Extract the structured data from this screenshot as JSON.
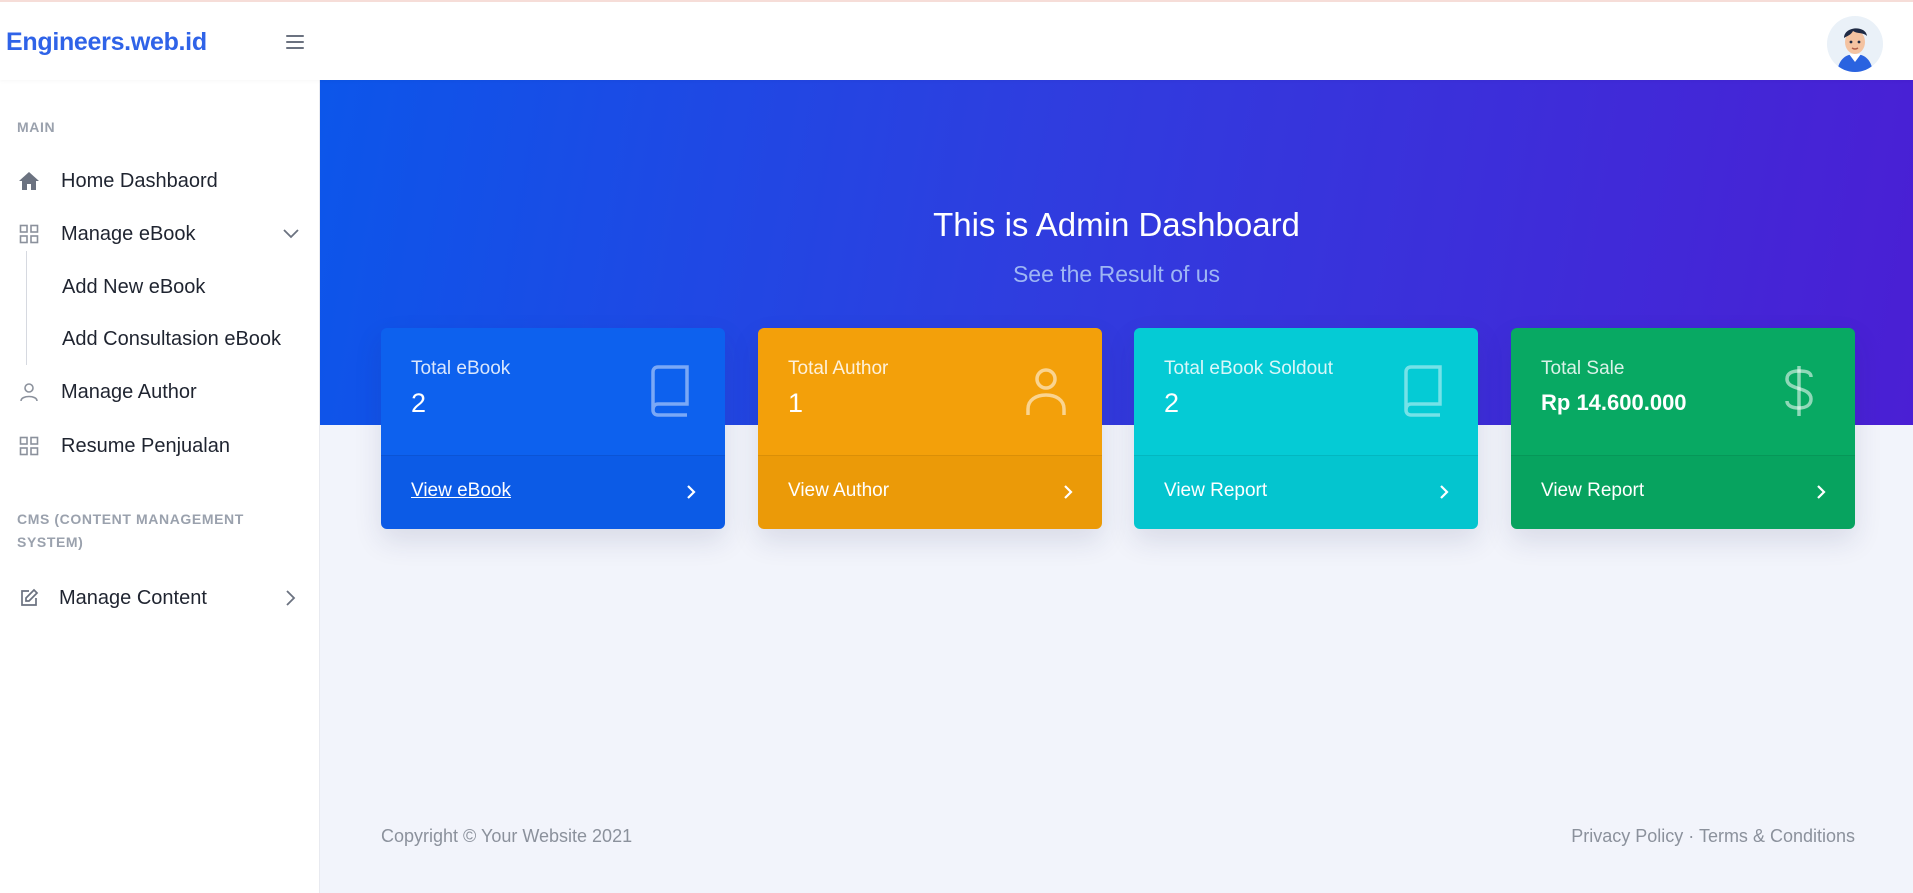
{
  "brand": "Engineers.web.id",
  "sidebar": {
    "heading_main": "MAIN",
    "items": [
      {
        "label": "Home Dashbaord",
        "icon": "home-icon"
      },
      {
        "label": "Manage eBook",
        "icon": "grid-icon"
      },
      {
        "label": "Manage Author",
        "icon": "user-icon"
      },
      {
        "label": "Resume Penjualan",
        "icon": "grid-icon"
      }
    ],
    "subitems": [
      "Add New eBook",
      "Add Consultasion eBook"
    ],
    "heading_cms": "CMS (CONTENT MANAGEMENT SYSTEM)",
    "cms_items": [
      {
        "label": "Manage Content",
        "icon": "edit-icon"
      }
    ]
  },
  "hero": {
    "title": "This is Admin Dashboard",
    "subtitle": "See the Result of us"
  },
  "cards": [
    {
      "label": "Total eBook",
      "value": "2",
      "link": "View eBook",
      "icon": "book-icon",
      "color": "#0d61ee"
    },
    {
      "label": "Total Author",
      "value": "1",
      "link": "View Author",
      "icon": "user-icon",
      "color": "#f3a00a"
    },
    {
      "label": "Total eBook Soldout",
      "value": "2",
      "link": "View Report",
      "icon": "book-icon",
      "color": "#05cbd5"
    },
    {
      "label": "Total Sale",
      "value": "Rp 14.600.000",
      "link": "View Report",
      "icon": "dollar-icon",
      "color": "#08a963"
    }
  ],
  "footer": {
    "copyright": "Copyright © Your Website 2021",
    "privacy": "Privacy Policy",
    "separator": " · ",
    "terms": "Terms & Conditions"
  },
  "colors": {
    "brand": "#2f63e8",
    "hero_start": "#0c56ea",
    "hero_end": "#4a1fd4",
    "background": "#f2f4fb"
  }
}
